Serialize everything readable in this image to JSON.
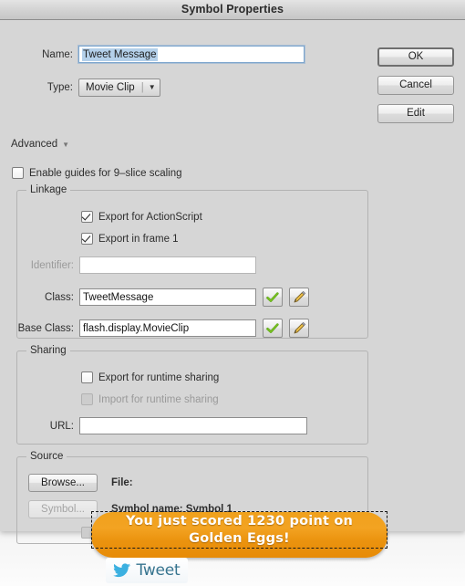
{
  "window": {
    "title": "Symbol Properties"
  },
  "fields": {
    "name_label": "Name:",
    "name_value": "Tweet Message",
    "type_label": "Type:",
    "type_value": "Movie Clip",
    "type_separator": "|",
    "type_arrow": "▼"
  },
  "buttons": {
    "ok": "OK",
    "cancel": "Cancel",
    "edit": "Edit"
  },
  "advanced": {
    "label": "Advanced",
    "arrow": "▼"
  },
  "nine_slice": {
    "label": "Enable guides for 9–slice scaling",
    "checked": false
  },
  "linkage": {
    "title": "Linkage",
    "export_actionscript": {
      "label": "Export for ActionScript",
      "checked": true
    },
    "export_frame1": {
      "label": "Export in frame 1",
      "checked": true
    },
    "identifier": {
      "label": "Identifier:",
      "value": "",
      "disabled": true
    },
    "class": {
      "label": "Class:",
      "value": "TweetMessage"
    },
    "base_class": {
      "label": "Base Class:",
      "value": "flash.display.MovieClip"
    },
    "validate_icon": "checkmark-icon",
    "edit_icon": "pencil-icon"
  },
  "sharing": {
    "title": "Sharing",
    "export_runtime": {
      "label": "Export for runtime sharing",
      "checked": false
    },
    "import_runtime": {
      "label": "Import for runtime sharing",
      "checked": false,
      "disabled": true
    },
    "url": {
      "label": "URL:",
      "value": ""
    }
  },
  "source": {
    "title": "Source",
    "browse_button": "Browse...",
    "symbol_button": "Symbol...",
    "file_label": "File:",
    "symbol_name_label": "Symbol name: Symbol 1"
  },
  "overlay": {
    "bubble_line1": "You just scored 1230 point on",
    "bubble_line2": "Golden Eggs!",
    "bubble_color": "#ef9c16",
    "tweet_label": "Tweet",
    "tweet_bird_icon": "twitter-bird-icon",
    "tweet_color": "#36748f"
  }
}
